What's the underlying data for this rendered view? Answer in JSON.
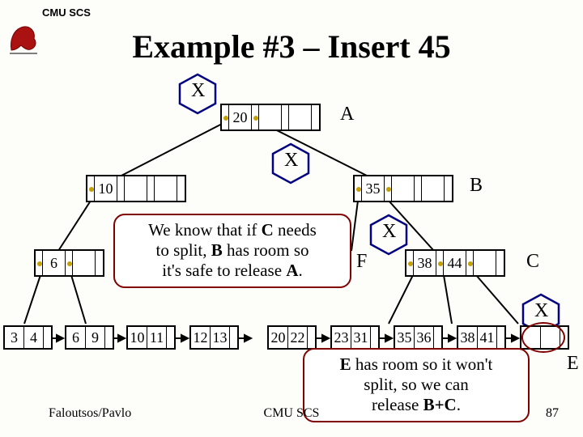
{
  "header": {
    "org": "CMU SCS"
  },
  "title": "Example #3 – Insert 45",
  "footer": {
    "authors": "Faloutsos/Pavlo",
    "center": "CMU SCS",
    "page": "87"
  },
  "markers": {
    "a": "A",
    "b": "B",
    "c": "C",
    "e": "E",
    "f": "F",
    "x": "X"
  },
  "callout1": {
    "line1_pre": "We know that if ",
    "line1_bold": "C",
    "line1_post": " needs",
    "line2_pre": "to split, ",
    "line2_bold": "B",
    "line2_post": " has room so",
    "line3_pre": "it's safe to release ",
    "line3_bold": "A",
    "line3_post": "."
  },
  "callout2": {
    "line1_bold": "E",
    "line1_post": " has room so it won't",
    "line2": "split, so we can",
    "line3_pre": "release ",
    "line3_bold": "B+C",
    "line3_post": "."
  },
  "nodes": {
    "root": {
      "keys": [
        "20",
        "",
        ""
      ]
    },
    "l1a": {
      "keys": [
        "10",
        "",
        ""
      ]
    },
    "l1b": {
      "keys": [
        "35",
        "",
        ""
      ]
    },
    "l2a": {
      "keys": [
        "6",
        "",
        ""
      ]
    },
    "l2f": {
      "keys": [
        "",
        "",
        ""
      ]
    },
    "l2c": {
      "keys": [
        "38",
        "44",
        ""
      ]
    },
    "leaf1": {
      "keys": [
        "3",
        "4"
      ]
    },
    "leaf2": {
      "keys": [
        "6",
        "9"
      ]
    },
    "leaf3": {
      "keys": [
        "10",
        "11"
      ]
    },
    "leaf4": {
      "keys": [
        "12",
        "13"
      ]
    },
    "leaf5": {
      "keys": [
        "20",
        "22"
      ]
    },
    "leaf6": {
      "keys": [
        "23",
        "31"
      ]
    },
    "leaf7": {
      "keys": [
        "35",
        "36"
      ]
    },
    "leaf8": {
      "keys": [
        "38",
        "41"
      ]
    },
    "leaf9": {
      "keys": [
        "",
        ""
      ]
    }
  },
  "chart_data": {
    "type": "diagram",
    "structure": "b-tree",
    "operation": "Insert 45",
    "levels": [
      {
        "label": "A",
        "nodes": [
          [
            20
          ]
        ]
      },
      {
        "label": "B",
        "nodes": [
          [
            10
          ],
          [
            35
          ]
        ]
      },
      {
        "label": "C/F",
        "nodes": [
          [
            6
          ],
          [],
          [
            38,
            44
          ]
        ]
      },
      {
        "label": "leaves",
        "nodes": [
          [
            3,
            4
          ],
          [
            6,
            9
          ],
          [
            10,
            11
          ],
          [
            12,
            13
          ],
          [
            20,
            22
          ],
          [
            23,
            31
          ],
          [
            35,
            36
          ],
          [
            38,
            41
          ],
          []
        ]
      }
    ],
    "lock_marks": [
      "A",
      "B",
      "C",
      "E (selected leaf)"
    ],
    "notes": [
      "We know that if C needs to split, B has room so it's safe to release A.",
      "E has room so it won't split, so we can release B+C."
    ]
  }
}
